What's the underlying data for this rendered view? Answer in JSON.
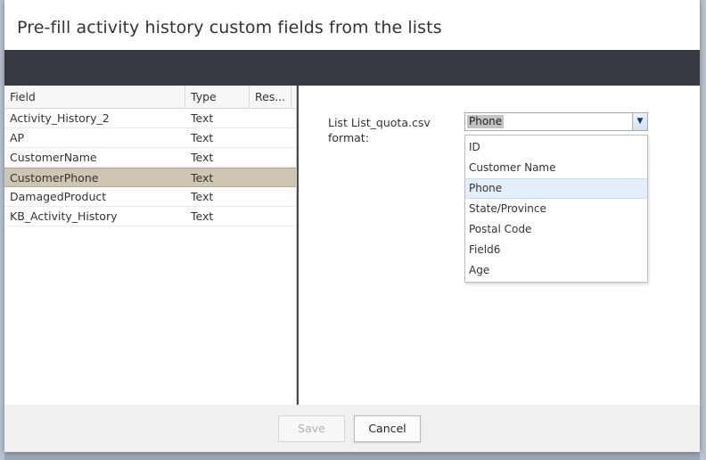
{
  "dialog": {
    "title": "Pre-fill activity history custom fields from the lists"
  },
  "grid": {
    "columns": [
      "Field",
      "Type",
      "Res..."
    ],
    "rows": [
      {
        "field": "Activity_History_2",
        "type": "Text",
        "selected": false
      },
      {
        "field": "AP",
        "type": "Text",
        "selected": false
      },
      {
        "field": "CustomerName",
        "type": "Text",
        "selected": false
      },
      {
        "field": "CustomerPhone",
        "type": "Text",
        "selected": true
      },
      {
        "field": "DamagedProduct",
        "type": "Text",
        "selected": false
      },
      {
        "field": "KB_Activity_History",
        "type": "Text",
        "selected": false
      }
    ]
  },
  "format": {
    "label_line1": "List List_quota.csv",
    "label_line2": "format:",
    "selected_value": "Phone",
    "options": [
      "ID",
      "Customer Name",
      "Phone",
      "State/Province",
      "Postal Code",
      "Field6",
      "Age"
    ],
    "highlighted_option": "Phone"
  },
  "footer": {
    "save_label": "Save",
    "cancel_label": "Cancel"
  },
  "colors": {
    "dark_band": "#353a42",
    "selected_row": "#cfc5b3",
    "highlighted_option": "#e3eefa"
  },
  "icons": {
    "select_arrow": "chevron-down-icon"
  }
}
